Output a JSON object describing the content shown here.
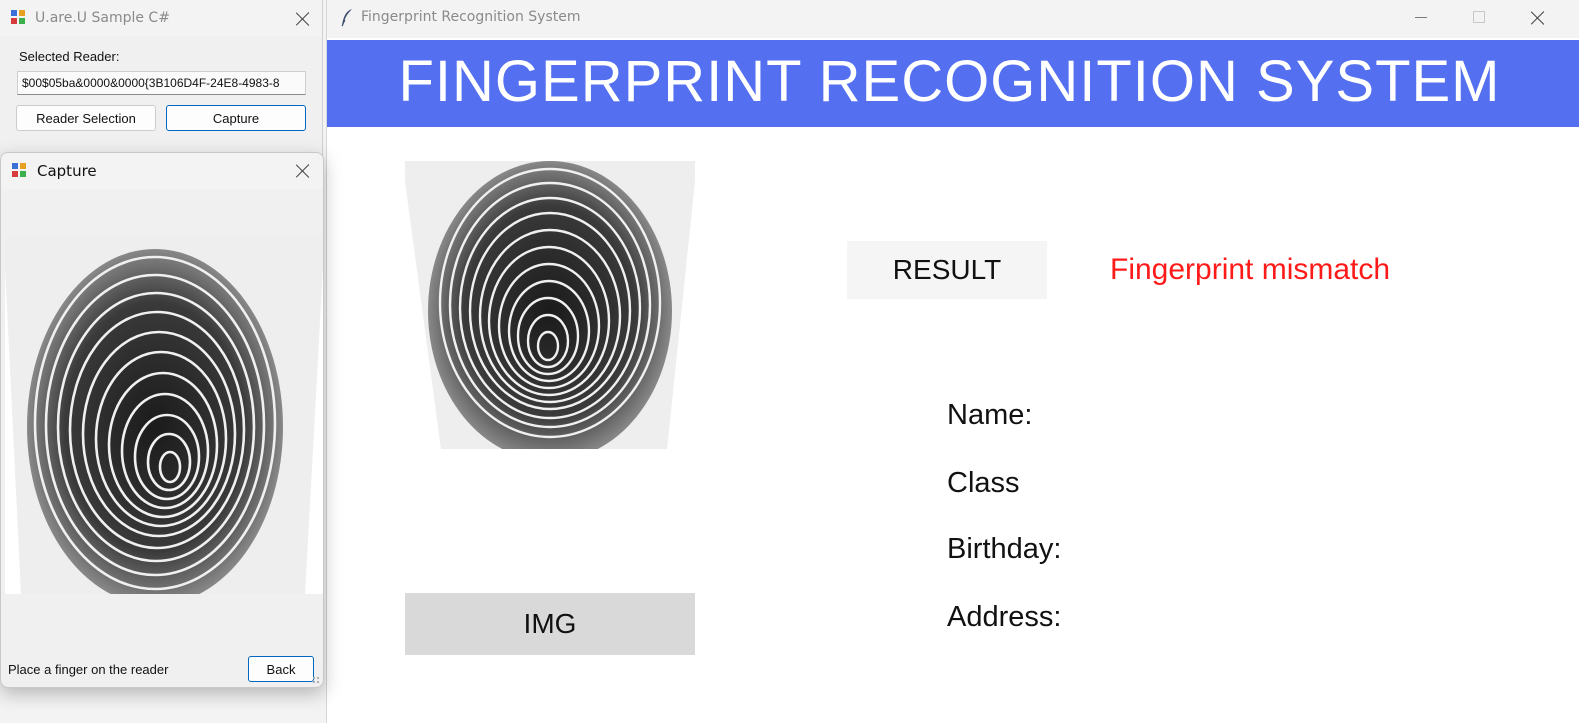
{
  "colors": {
    "header_bg": "#5470f0",
    "header_text": "#ffffff",
    "result_error": "#ff1a1a",
    "img_button_bg": "#d9d9d9",
    "accent_border": "#0067c0"
  },
  "main_window": {
    "title": "Fingerprint Recognition System",
    "title_icon": "feather-icon",
    "header_title": "FINGERPRINT RECOGNITION SYSTEM",
    "result_button_label": "RESULT",
    "result_text": "Fingerprint mismatch",
    "img_button_label": "IMG",
    "info_labels": {
      "name": "Name:",
      "class": "Class",
      "birthday": "Birthday:",
      "address": "Address:"
    },
    "controls": [
      "minimize-icon",
      "maximize-icon",
      "close-icon"
    ]
  },
  "sample_window": {
    "title": "U.are.U Sample C#",
    "selected_reader_label": "Selected Reader:",
    "reader_value": "$00$05ba&0000&0000{3B106D4F-24E8-4983-8",
    "reader_selection_button": "Reader Selection",
    "capture_button": "Capture"
  },
  "capture_window": {
    "title": "Capture",
    "status_text": "Place a finger on the reader",
    "back_button": "Back"
  }
}
